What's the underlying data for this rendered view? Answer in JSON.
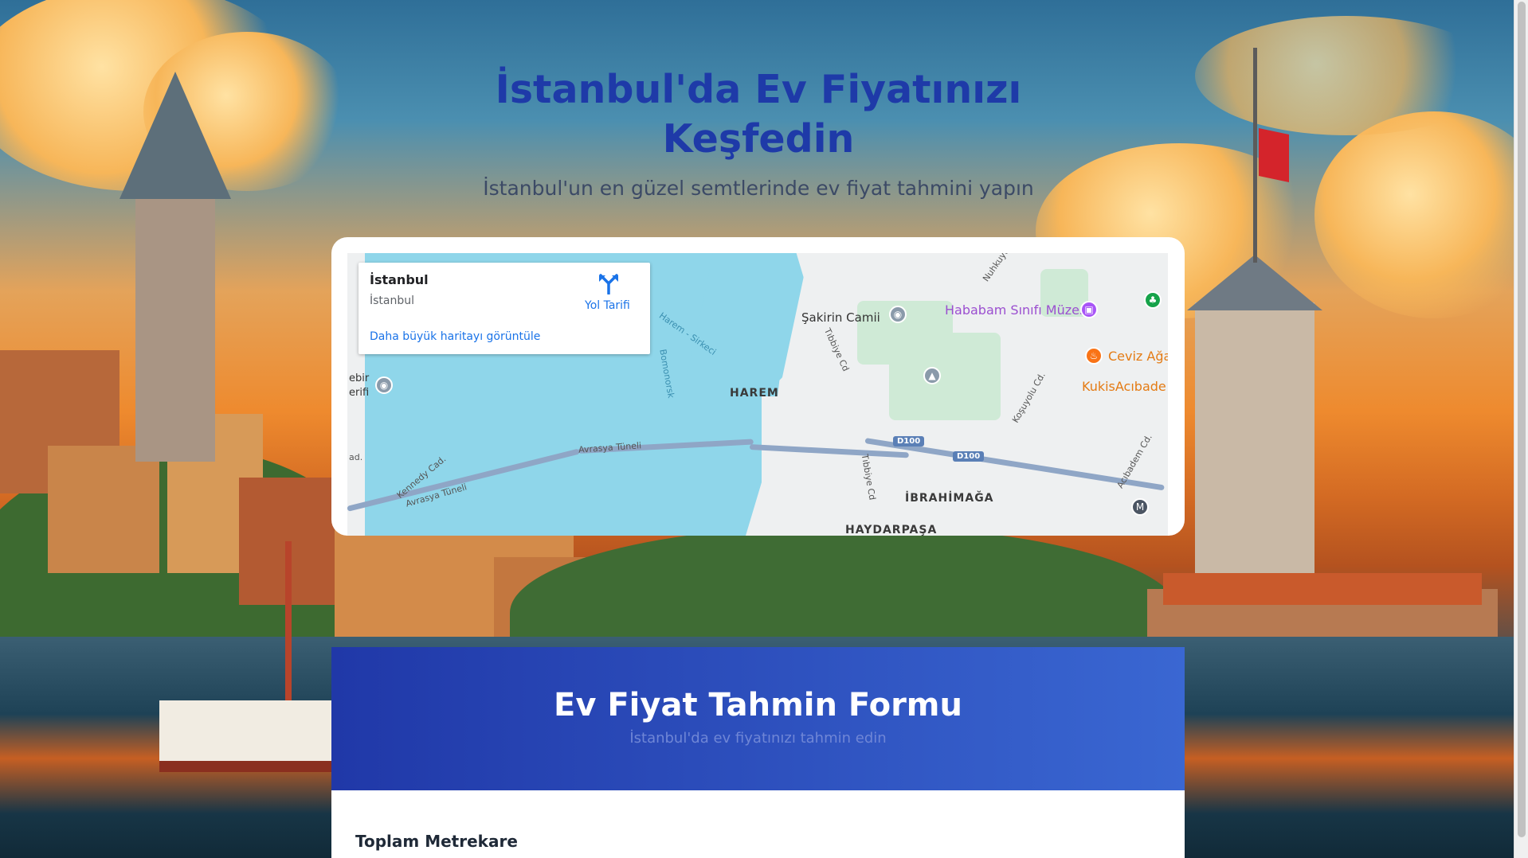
{
  "hero": {
    "title_line1": "İstanbul'da Ev Fiyatınızı",
    "title_line2": "Keşfedin",
    "subtitle": "İstanbul'un en güzel semtlerinde ev fiyat tahmini yapın"
  },
  "map": {
    "info": {
      "place": "İstanbul",
      "region": "İstanbul",
      "directions_label": "Yol Tarifi",
      "larger_map_link": "Daha büyük haritayı görüntüle"
    },
    "labels": {
      "sakirin": "Şakirin Camii",
      "hababam": "Hababam Sınıfı Müzesi",
      "ceviz": "Ceviz Ağa",
      "kukis": "KukisAcıbade",
      "harem": "HAREM",
      "ibrahimaga": "İBRAHİMAĞA",
      "haydarpasa": "HAYDARPAŞA",
      "avrasya1": "Avrasya Tüneli",
      "avrasya2": "Avrasya Tüneli",
      "kennedy": "Kennedy Cad.",
      "harem_sirkeci": "Harem - Sirkeci",
      "tibbiye1": "Tıbbiye Cd",
      "tibbiye2": "Tıbbiye Cd",
      "kosuyolu": "Koşuyolu Cd.",
      "acibadem": "Acıbadem Cd.",
      "d100a": "D100",
      "d100b": "D100",
      "edge_left1": "ebir",
      "edge_left2": "erifi",
      "edge_left3": "ad.",
      "edge_top": "Nuhkuyu",
      "bogaz": "Bomonorsk",
      "metro": "M"
    }
  },
  "form": {
    "title": "Ev Fiyat Tahmin Formu",
    "subtitle": "İstanbul'da ev fiyatınızı tahmin edin",
    "field_total_area_label": "Toplam Metrekare"
  },
  "colors": {
    "title_blue": "#1e3aa8",
    "form_header_start": "#2038a8",
    "form_header_end": "#3a67d2",
    "link_blue": "#1a73e8"
  }
}
